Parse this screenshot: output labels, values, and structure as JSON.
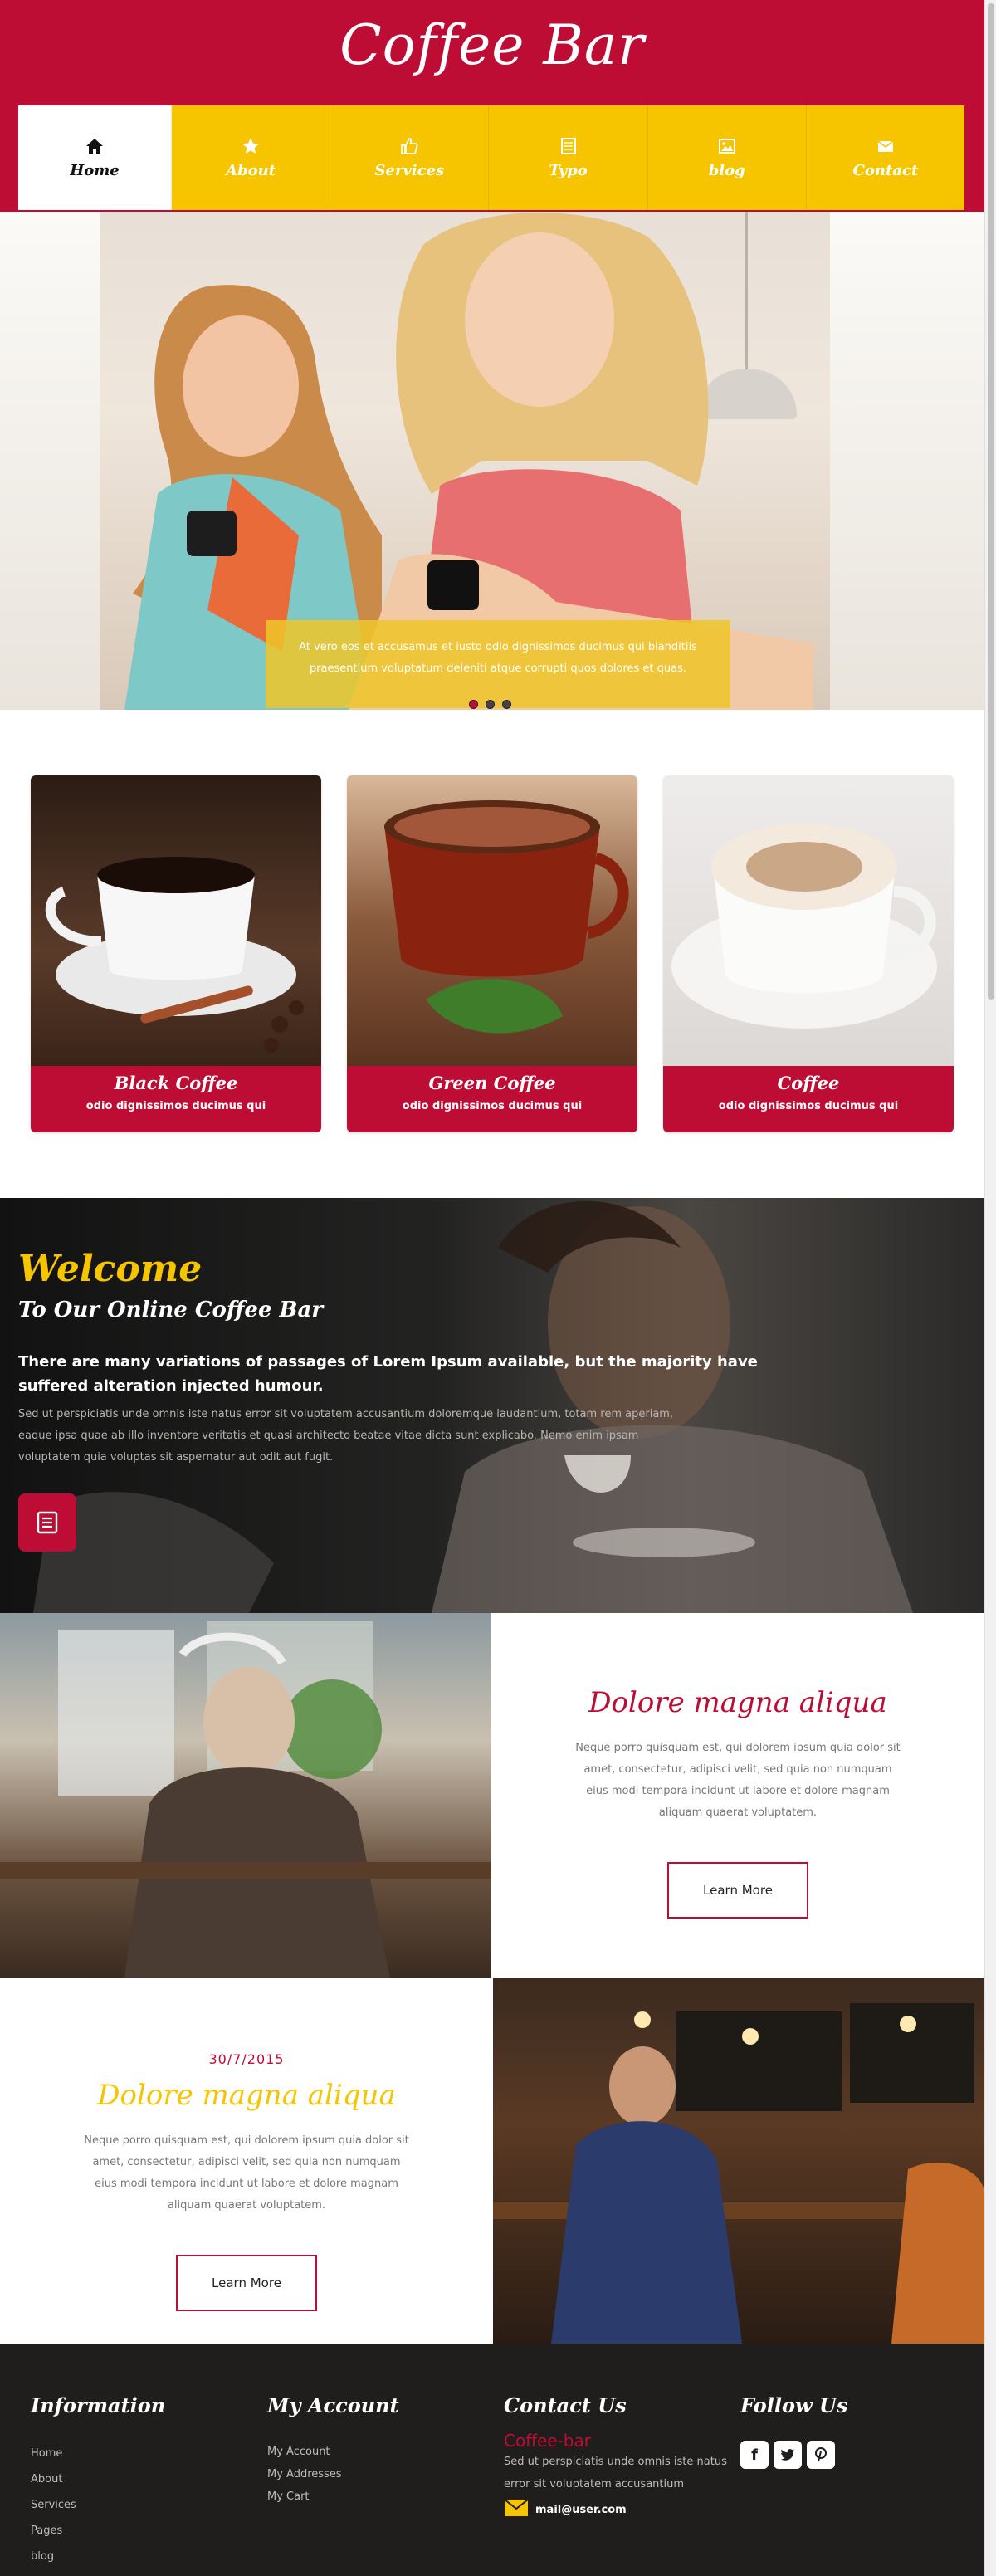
{
  "header": {
    "logo": "Coffee Bar",
    "nav": [
      {
        "label": "Home",
        "icon": "home-icon",
        "active": true
      },
      {
        "label": "About",
        "icon": "star-icon"
      },
      {
        "label": "Services",
        "icon": "thumbs-up-icon"
      },
      {
        "label": "Typo",
        "icon": "document-icon"
      },
      {
        "label": "blog",
        "icon": "image-icon"
      },
      {
        "label": "Contact",
        "icon": "envelope-icon"
      }
    ]
  },
  "hero": {
    "caption_line1": "At vero eos et accusamus et iusto odio dignissimos ducimus qui blanditiis",
    "caption_line2": "praesentium voluptatum deleniti atque corrupti quos dolores et quas.",
    "slide_count": 3,
    "active_slide": 1
  },
  "products": [
    {
      "title": "Black Coffee",
      "subtitle": "odio dignissimos ducimus qui"
    },
    {
      "title": "Green Coffee",
      "subtitle": "odio dignissimos ducimus qui"
    },
    {
      "title": "Coffee",
      "subtitle": "odio dignissimos ducimus qui"
    }
  ],
  "welcome": {
    "title": "Welcome",
    "subtitle": "To Our Online Coffee Bar",
    "lead": "There are many variations of passages of Lorem Ipsum available, but the majority have suffered alteration injected humour.",
    "body": "Sed ut perspiciatis unde omnis iste natus error sit voluptatem accusantium doloremque laudantium, totam rem aperiam, eaque ipsa quae ab illo inventore veritatis et quasi architecto beatae vitae dicta sunt explicabo. Nemo enim ipsam voluptatem quia voluptas sit aspernatur aut odit aut fugit.",
    "button_icon": "list-icon"
  },
  "feature1": {
    "title": "Dolore magna aliqua",
    "body": "Neque porro quisquam est, qui dolorem ipsum quia dolor sit amet, consectetur, adipisci velit, sed quia non numquam eius modi tempora incidunt ut labore et dolore magnam aliquam quaerat voluptatem.",
    "button": "Learn More"
  },
  "feature2": {
    "date": "30/7/2015",
    "title": "Dolore magna aliqua",
    "body": "Neque porro quisquam est, qui dolorem ipsum quia dolor sit amet, consectetur, adipisci velit, sed quia non numquam eius modi tempora incidunt ut labore et dolore magnam aliquam quaerat voluptatem.",
    "button": "Learn More"
  },
  "footer": {
    "information": {
      "heading": "Information",
      "links": [
        "Home",
        "About",
        "Services",
        "Pages",
        "blog"
      ]
    },
    "account": {
      "heading": "My Account",
      "links": [
        "My Account",
        "My Addresses",
        "My Cart"
      ]
    },
    "contact": {
      "heading": "Contact Us",
      "brand": "Coffee-bar",
      "text": "Sed ut perspiciatis unde omnis iste natus error sit voluptatem accusantium",
      "email": "mail@user.com"
    },
    "follow": {
      "heading": "Follow Us",
      "icons": [
        "facebook-icon",
        "twitter-icon",
        "pinterest-icon"
      ]
    }
  },
  "colors": {
    "primary": "#bd0d34",
    "accent": "#f6c500",
    "footer": "#1f1e1d"
  }
}
